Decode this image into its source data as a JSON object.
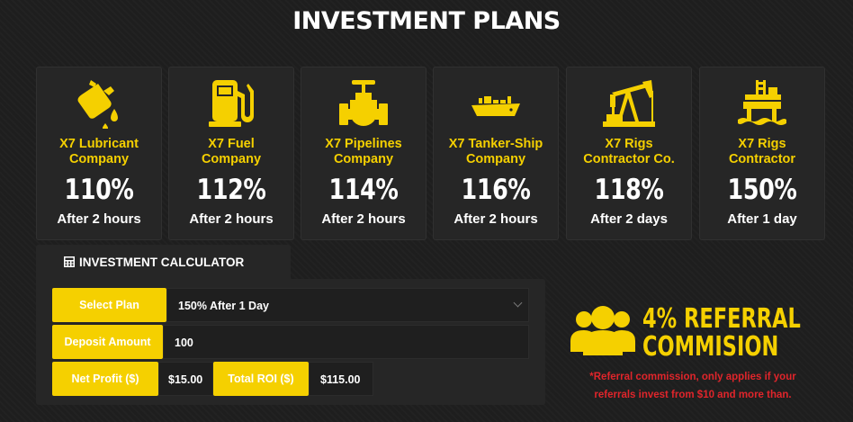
{
  "page": {
    "title": "INVESTMENT PLANS"
  },
  "colors": {
    "accent": "#f5d000",
    "card_bg": "#262626",
    "note": "#e0252b"
  },
  "plans": [
    {
      "icon": "oil-can-icon",
      "name_line1": "X7 Lubricant",
      "name_line2": "Company",
      "percent": "110%",
      "duration": "After 2 hours"
    },
    {
      "icon": "fuel-pump-icon",
      "name_line1": "X7 Fuel",
      "name_line2": "Company",
      "percent": "112%",
      "duration": "After 2 hours"
    },
    {
      "icon": "pipeline-valve-icon",
      "name_line1": "X7 Pipelines",
      "name_line2": "Company",
      "percent": "114%",
      "duration": "After 2 hours"
    },
    {
      "icon": "tanker-ship-icon",
      "name_line1": "X7 Tanker-Ship",
      "name_line2": "Company",
      "percent": "116%",
      "duration": "After 2 hours"
    },
    {
      "icon": "oil-pumpjack-icon",
      "name_line1": "X7 Rigs",
      "name_line2": "Contractor Co.",
      "percent": "118%",
      "duration": "After 2 days"
    },
    {
      "icon": "oil-rig-icon",
      "name_line1": "X7 Rigs",
      "name_line2": "Contractor",
      "percent": "150%",
      "duration": "After 1 day"
    }
  ],
  "calculator": {
    "tab_label": "INVESTMENT CALCULATOR",
    "tab_icon": "calculator-icon",
    "select_plan_label": "Select Plan",
    "selected_plan": "150% After 1 Day",
    "deposit_label": "Deposit Amount",
    "deposit_value": "100",
    "net_profit_label": "Net Profit ($)",
    "net_profit_value": "$15.00",
    "total_roi_label": "Total ROI ($)",
    "total_roi_value": "$115.00"
  },
  "referral": {
    "icon": "users-group-icon",
    "title_line1": "4% REFERRAL",
    "title_line2": "COMMISION",
    "note_line1": "*Referral commission, only applies if your",
    "note_line2": "referrals invest from $10 and more than."
  }
}
